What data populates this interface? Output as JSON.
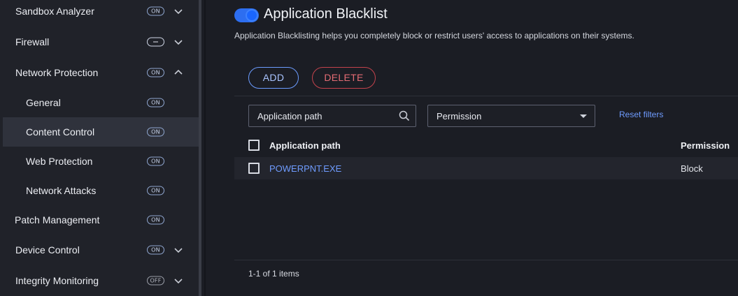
{
  "sidebar": {
    "items": [
      {
        "label": "Sandbox Analyzer",
        "status": "ON",
        "chevron": "chevron-down-icon"
      },
      {
        "label": "Firewall",
        "status": "minus",
        "chevron": "chevron-down-icon"
      },
      {
        "label": "Network Protection",
        "status": "ON",
        "chevron": "chevron-up-icon"
      },
      {
        "label": "General",
        "status": "ON"
      },
      {
        "label": "Content Control",
        "status": "ON",
        "active": true
      },
      {
        "label": "Web Protection",
        "status": "ON"
      },
      {
        "label": "Network Attacks",
        "status": "ON"
      },
      {
        "label": "Patch Management",
        "status": "ON"
      },
      {
        "label": "Device Control",
        "status": "ON",
        "chevron": "chevron-down-icon"
      },
      {
        "label": "Integrity Monitoring",
        "status": "OFF",
        "chevron": "chevron-down-icon"
      }
    ]
  },
  "main": {
    "toggle_state": "on",
    "title": "Application Blacklist",
    "description": "Application Blacklisting helps you completely block or restrict users' access to applications on their systems.",
    "buttons": {
      "add": "ADD",
      "delete": "DELETE"
    },
    "filters": {
      "search_placeholder": "Application path",
      "permission_value": "Permission",
      "reset": "Reset filters"
    },
    "table": {
      "headers": [
        "Application path",
        "Permission"
      ],
      "rows": [
        {
          "path": "POWERPNT.EXE",
          "permission": "Block"
        }
      ]
    },
    "pager": "1-1 of 1 items"
  },
  "colors": {
    "accent": "#2d6ef0",
    "link": "#6f9cff",
    "danger": "#c4434d",
    "sidebar_bg": "#202229",
    "main_bg": "#1b1d24"
  }
}
